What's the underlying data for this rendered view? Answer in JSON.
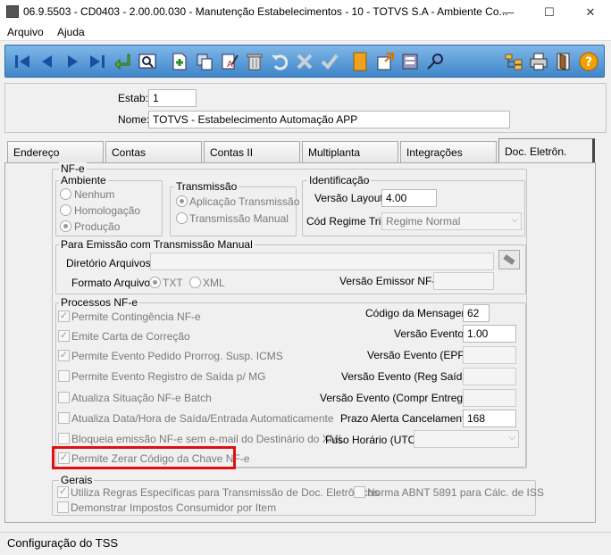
{
  "window": {
    "title": "06.9.5503 - CD0403 - 2.00.00.030 - Manutenção Estabelecimentos - 10 - TOTVS S.A - Ambiente Co...",
    "minimize": "—",
    "maximize": "☐",
    "close": "✕"
  },
  "menu": {
    "arquivo": "Arquivo",
    "ajuda": "Ajuda"
  },
  "toolbar": {
    "icons": [
      "first-record",
      "prev-record",
      "next-record",
      "last-record",
      "goto",
      "search-zoom",
      "new-record",
      "copy-record",
      "edit-record",
      "delete-record",
      "undo",
      "cancel",
      "confirm",
      "notes",
      "export",
      "import",
      "key",
      "tree",
      "print",
      "exit",
      "help"
    ]
  },
  "header": {
    "estab_label": "Estab:",
    "estab_value": "1",
    "nome_label": "Nome:",
    "nome_value": "TOTVS - Estabelecimento Automação APP"
  },
  "tabs": [
    "Endereço",
    "Contas",
    "Contas II",
    "Multiplanta",
    "Integrações",
    "Doc. Eletrôn."
  ],
  "nfe": {
    "title": "NF-e",
    "ambiente": {
      "title": "Ambiente",
      "options": [
        "Nenhum",
        "Homologação",
        "Produção"
      ],
      "selected": "Produção"
    },
    "transmissao": {
      "title": "Transmissão",
      "options": [
        "Aplicação Transmissão",
        "Transmissão Manual"
      ],
      "selected": "Aplicação Transmissão"
    },
    "identificacao": {
      "title": "Identificação",
      "versao_layout_label": "Versão Layout:",
      "versao_layout_value": "4.00",
      "cod_regime_label": "Cód Regime Trib:",
      "cod_regime_value": "Regime Normal"
    }
  },
  "emissao": {
    "title": "Para Emissão com Transmissão Manual",
    "diretorio_label": "Diretório Arquivos:",
    "diretorio_value": "",
    "formato_label": "Formato Arquivo:",
    "formato_options": [
      "TXT",
      "XML"
    ],
    "formato_selected": "TXT",
    "versao_emissor_label": "Versão Emissor NF-e:",
    "versao_emissor_value": ""
  },
  "processos": {
    "title": "Processos NF-e",
    "checks": [
      {
        "label": "Permite Contingência NF-e",
        "checked": true
      },
      {
        "label": "Emite Carta de Correção",
        "checked": true
      },
      {
        "label": "Permite Evento Pedido Prorrog. Susp. ICMS",
        "checked": true
      },
      {
        "label": "Permite Evento Registro de Saída p/ MG",
        "checked": false
      },
      {
        "label": "Atualiza Situação NF-e Batch",
        "checked": false
      },
      {
        "label": "Atualiza Data/Hora de Saída/Entrada Automaticamente",
        "checked": false
      },
      {
        "label": "Bloqueia emissão NF-e sem e-mail do Destinário do XML",
        "checked": false
      },
      {
        "label": "Permite Zerar Código da Chave NF-e",
        "checked": true
      }
    ],
    "fields": [
      {
        "label": "Código da Mensagem:",
        "value": "62"
      },
      {
        "label": "Versão Evento:",
        "value": "1.00"
      },
      {
        "label": "Versão Evento (EPP):",
        "value": ""
      },
      {
        "label": "Versão Evento (Reg Saída):",
        "value": ""
      },
      {
        "label": "Versão Evento (Compr Entrega):",
        "value": ""
      },
      {
        "label": "Prazo Alerta Cancelamento:",
        "value": "168"
      },
      {
        "label": "Fuso Horário (UTC):",
        "value": ""
      }
    ]
  },
  "gerais": {
    "title": "Gerais",
    "checks": [
      {
        "label": "Utiliza Regras Específicas para Transmissão de Doc. Eletrônicos",
        "checked": true
      },
      {
        "label": "Norma ABNT 5891 para Cálc. de ISS",
        "checked": false
      },
      {
        "label": "Demonstrar Impostos Consumidor por Item",
        "checked": false
      }
    ]
  },
  "status": {
    "text": "Configuração do TSS"
  },
  "colors": {
    "toolbar": "#3f86c9",
    "highlight": "#e01010"
  }
}
